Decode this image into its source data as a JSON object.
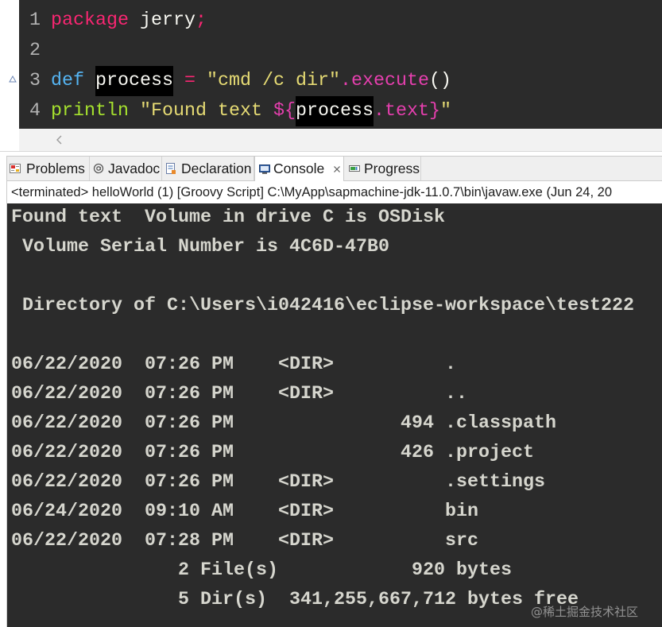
{
  "theme": {
    "editor_background": "#2b2b2b",
    "line_number_color": "#b4b4b4",
    "console_background": "#2b2b2b",
    "console_foreground": "#d6d6ce",
    "occurrence_highlight": "#000000"
  },
  "editor": {
    "lines": [
      {
        "number": "1",
        "tokens": [
          {
            "text": "package",
            "color": "#f92672"
          },
          {
            "text": " jerry",
            "color": "#f8f8f2"
          },
          {
            "text": ";",
            "color": "#f92672"
          }
        ]
      },
      {
        "number": "2",
        "tokens": []
      },
      {
        "number": "3",
        "marker": "override-triangle-icon",
        "tokens": [
          {
            "text": "def ",
            "color": "#55b4f2"
          },
          {
            "text": "process",
            "color": "#f8f8f2",
            "highlight": "#000000"
          },
          {
            "text": " = ",
            "color": "#f92672"
          },
          {
            "text": "\"cmd /c dir\"",
            "color": "#e6db74"
          },
          {
            "text": ".execute",
            "color": "#e53fae"
          },
          {
            "text": "()",
            "color": "#f8f8f2"
          }
        ]
      },
      {
        "number": "4",
        "tokens": [
          {
            "text": "println ",
            "color": "#a6e22e"
          },
          {
            "text": "\"Found text ",
            "color": "#e6db74"
          },
          {
            "text": "${",
            "color": "#e53fae"
          },
          {
            "text": "process",
            "color": "#f8f8f2",
            "highlight": "#000000"
          },
          {
            "text": ".text}",
            "color": "#e53fae"
          },
          {
            "text": "\"",
            "color": "#e6db74"
          }
        ]
      }
    ],
    "scroll_icon": "chevron-left-icon"
  },
  "views": {
    "tabs": [
      {
        "label": "Problems",
        "icon": "problems-icon"
      },
      {
        "label": "Javadoc",
        "icon": "javadoc-icon"
      },
      {
        "label": "Declaration",
        "icon": "declaration-icon"
      },
      {
        "label": "Console",
        "icon": "console-icon",
        "active": true,
        "closable": true
      },
      {
        "label": "Progress",
        "icon": "progress-icon"
      }
    ]
  },
  "console": {
    "status": "<terminated> helloWorld (1) [Groovy Script] C:\\MyApp\\sapmachine-jdk-11.0.7\\bin\\javaw.exe (Jun 24, 20",
    "lines": [
      "Found text  Volume in drive C is OSDisk",
      " Volume Serial Number is 4C6D-47B0",
      "",
      " Directory of C:\\Users\\i042416\\eclipse-workspace\\test222",
      "",
      "06/22/2020  07:26 PM    <DIR>          .",
      "06/22/2020  07:26 PM    <DIR>          ..",
      "06/22/2020  07:26 PM               494 .classpath",
      "06/22/2020  07:26 PM               426 .project",
      "06/22/2020  07:26 PM    <DIR>          .settings",
      "06/24/2020  09:10 AM    <DIR>          bin",
      "06/22/2020  07:28 PM    <DIR>          src",
      "               2 File(s)            920 bytes",
      "               5 Dir(s)  341,255,667,712 bytes free"
    ]
  },
  "watermark": "@稀土掘金技术社区"
}
